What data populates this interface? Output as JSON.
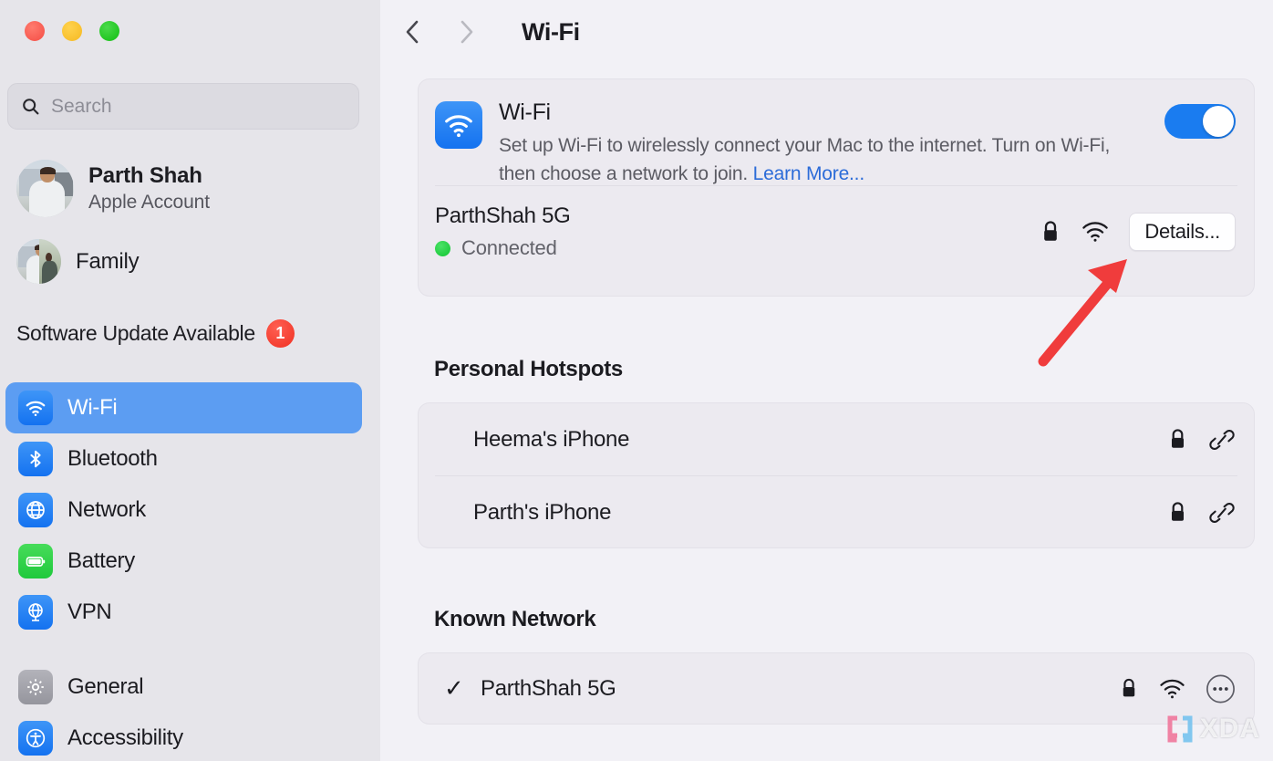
{
  "window": {
    "traffic_lights": [
      "close",
      "minimize",
      "zoom"
    ],
    "colors": {
      "sidebar_bg": "#e6e5ea",
      "content_bg": "#f2f1f6",
      "card_bg": "#eceaf0",
      "accent_blue": "#1a7cf0",
      "selection_blue": "#5c9df2",
      "badge_red": "#f33b2d",
      "connected_green": "#1fcc3f",
      "link_blue": "#2c6cd8",
      "annotation_red": "#f03c3c"
    }
  },
  "sidebar": {
    "search": {
      "placeholder": "Search",
      "value": "",
      "icon": "search-icon"
    },
    "account": {
      "name": "Parth Shah",
      "subtitle": "Apple Account"
    },
    "family": {
      "label": "Family"
    },
    "update": {
      "label": "Software Update Available",
      "badge_count": "1"
    },
    "items": [
      {
        "label": "Wi-Fi",
        "icon": "wifi-icon",
        "selected": true
      },
      {
        "label": "Bluetooth",
        "icon": "bluetooth-icon",
        "selected": false
      },
      {
        "label": "Network",
        "icon": "globe-icon",
        "selected": false
      },
      {
        "label": "Battery",
        "icon": "battery-icon",
        "selected": false
      },
      {
        "label": "VPN",
        "icon": "vpn-globe-icon",
        "selected": false
      },
      {
        "label": "General",
        "icon": "gear-icon",
        "selected": false
      },
      {
        "label": "Accessibility",
        "icon": "accessibility-icon",
        "selected": false
      }
    ]
  },
  "toolbar": {
    "back_icon": "chevron-left-icon",
    "forward_icon": "chevron-right-icon",
    "title": "Wi-Fi"
  },
  "wifi_card": {
    "icon": "wifi-app-icon",
    "title": "Wi-Fi",
    "description": "Set up Wi-Fi to wirelessly connect your Mac to the internet. Turn on Wi-Fi, then choose a network to join.",
    "learn_more": "Learn More...",
    "toggle": {
      "state": "on"
    },
    "connected_network": {
      "ssid": "ParthShah 5G",
      "status": "Connected",
      "lock_icon": "lock-icon",
      "signal_icon": "wifi-signal-icon",
      "details_button": "Details..."
    }
  },
  "hotspots": {
    "title": "Personal Hotspots",
    "rows": [
      {
        "name": "Heema's iPhone",
        "lock_icon": "lock-icon",
        "link_icon": "chain-link-icon"
      },
      {
        "name": "Parth's iPhone",
        "lock_icon": "lock-icon",
        "link_icon": "chain-link-icon"
      }
    ]
  },
  "known_network": {
    "title": "Known Network",
    "rows": [
      {
        "check": "✓",
        "name": "ParthShah 5G",
        "lock_icon": "lock-icon",
        "signal_icon": "wifi-signal-icon",
        "more_icon": "more-options-icon"
      }
    ]
  },
  "annotation": {
    "arrow_color": "#f03c3c",
    "points_at": "Details... button"
  },
  "watermark": {
    "text": "XDA"
  }
}
